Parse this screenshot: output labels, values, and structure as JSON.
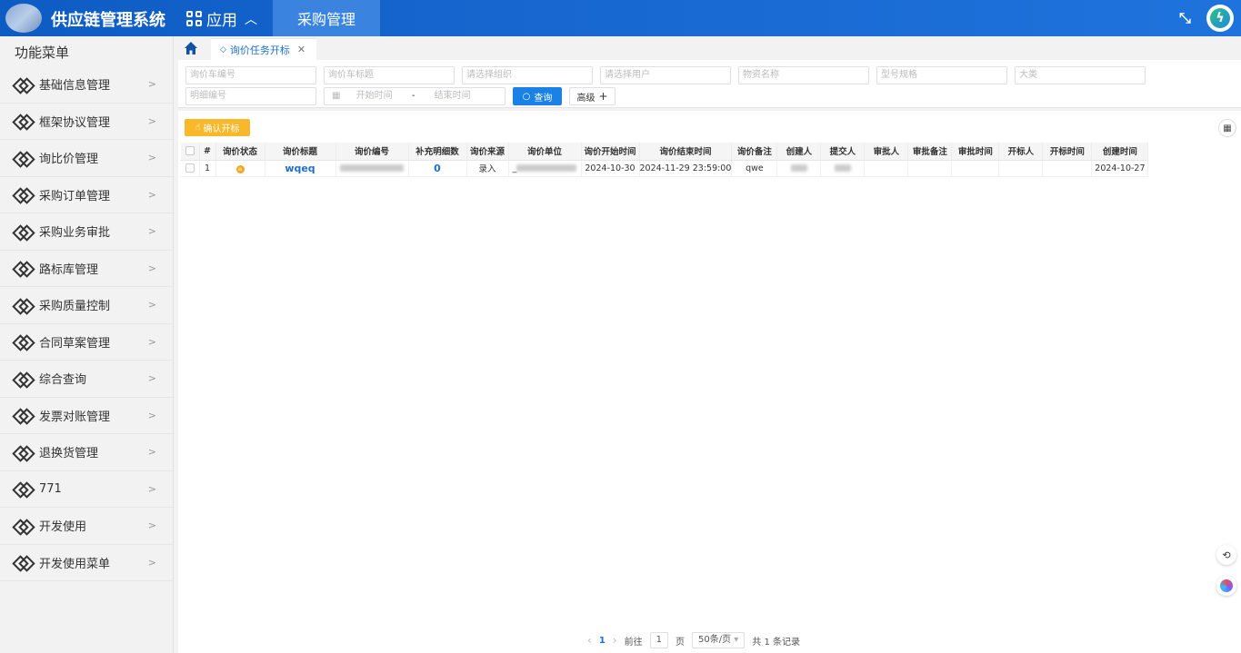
{
  "header": {
    "app_title": "供应链管理系统",
    "apps_label": "应用",
    "active_tab": "采购管理"
  },
  "sidebar": {
    "title": "功能菜单",
    "items": [
      {
        "label": "基础信息管理"
      },
      {
        "label": "框架协议管理"
      },
      {
        "label": "询比价管理"
      },
      {
        "label": "采购订单管理"
      },
      {
        "label": "采购业务审批"
      },
      {
        "label": "路标库管理"
      },
      {
        "label": "采购质量控制"
      },
      {
        "label": "合同草案管理"
      },
      {
        "label": "综合查询"
      },
      {
        "label": "发票对账管理"
      },
      {
        "label": "退换货管理"
      },
      {
        "label": "771"
      },
      {
        "label": "开发使用"
      },
      {
        "label": "开发使用菜单"
      }
    ]
  },
  "tabs": {
    "current": "询价任务开标"
  },
  "filters": {
    "cart_no": "询价车编号",
    "cart_title": "询价车标题",
    "org": "请选择组织",
    "user": "请选择用户",
    "material": "物资名称",
    "spec": "型号规格",
    "category": "大类",
    "detail_no": "明细编号",
    "start_time": "开始时间",
    "sep": "-",
    "end_time": "结束时间",
    "query_label": "查询",
    "advanced_label": "高级"
  },
  "toolbar": {
    "confirm_label": "确认开标"
  },
  "table": {
    "columns": [
      "#",
      "询价状态",
      "询价标题",
      "询价编号",
      "补充明细数",
      "询价来源",
      "询价单位",
      "询价开始时间",
      "询价结束时间",
      "询价备注",
      "创建人",
      "提交人",
      "审批人",
      "审批备注",
      "审批时间",
      "开标人",
      "开标时间",
      "创建时间"
    ],
    "rows": [
      {
        "index": "1",
        "title": "wqeq",
        "detail_count": "0",
        "source": "录入",
        "unit_prefix": "_",
        "start": "2024-10-30",
        "end": "2024-11-29 23:59:00",
        "remark": "qwe",
        "created": "2024-10-27"
      }
    ]
  },
  "pagination": {
    "page": "1",
    "goto_label": "前往",
    "goto_value": "1",
    "page_unit": "页",
    "page_size": "50条/页",
    "total": "共 1 条记录"
  }
}
